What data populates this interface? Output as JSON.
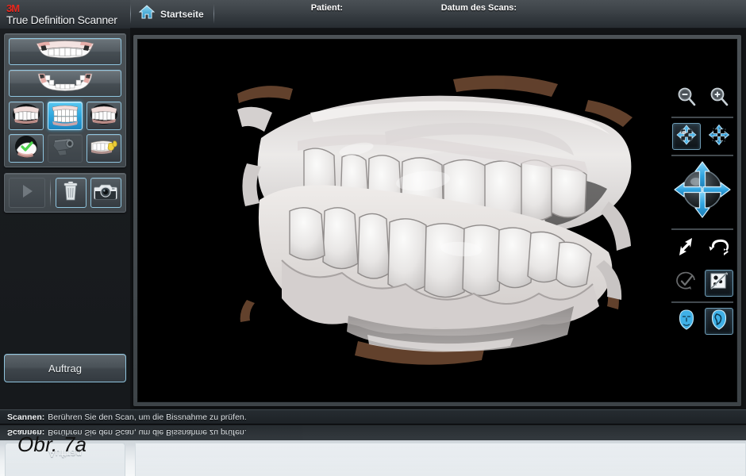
{
  "header": {
    "brand_logo": "3M",
    "brand_name": "True Definition Scanner",
    "home_label": "Startseite",
    "home_icon": "home-icon",
    "patient_label": "Patient:",
    "patient_value": "",
    "scandate_label": "Datum des Scans:",
    "scandate_value": ""
  },
  "sidebar": {
    "arch_buttons": [
      {
        "name": "upper-arch-button",
        "icon": "upper-dental-arch-icon",
        "label": "",
        "selected": false
      },
      {
        "name": "lower-arch-button",
        "icon": "lower-dental-arch-icon",
        "label": "",
        "selected": false
      }
    ],
    "view_tools": [
      {
        "name": "view-buccal-left-button",
        "icon": "teeth-left-buccal-icon",
        "selected": false
      },
      {
        "name": "view-bite-front-button",
        "icon": "teeth-front-bite-icon",
        "selected": true
      },
      {
        "name": "view-buccal-right-button",
        "icon": "teeth-right-buccal-icon",
        "selected": false
      },
      {
        "name": "margin-marking-button",
        "icon": "tooth-prep-check-icon",
        "selected": false
      },
      {
        "name": "scanner-wand-button",
        "icon": "scanner-handpiece-icon",
        "selected": false,
        "disabled": true
      },
      {
        "name": "restoration-button",
        "icon": "crown-restoration-icon",
        "selected": false
      }
    ],
    "actions": [
      {
        "name": "play-button",
        "icon": "play-triangle-icon",
        "disabled": true
      },
      {
        "name": "delete-button",
        "icon": "trash-can-icon",
        "disabled": false
      },
      {
        "name": "camera-button",
        "icon": "camera-icon",
        "disabled": false
      }
    ],
    "order_button_label": "Auftrag"
  },
  "rail": {
    "rows": [
      [
        {
          "name": "zoom-out-button",
          "icon": "magnifier-minus-icon",
          "state": "normal"
        },
        {
          "name": "zoom-in-button",
          "icon": "magnifier-plus-icon",
          "state": "normal"
        }
      ],
      [
        {
          "name": "rotate-model-button",
          "icon": "rotate-model-arrows-icon",
          "state": "selected"
        },
        {
          "name": "pan-model-button",
          "icon": "pan-four-arrows-icon",
          "state": "normal"
        }
      ],
      [
        {
          "name": "navigation-pad",
          "icon": "four-way-navigation-sphere-icon",
          "state": "normal"
        }
      ],
      [
        {
          "name": "rotate-diagonal-button",
          "icon": "diagonal-rotate-arrows-icon",
          "state": "normal"
        },
        {
          "name": "rotate-circular-button",
          "icon": "circular-rotate-arrow-icon",
          "state": "normal"
        }
      ],
      [
        {
          "name": "accept-scan-button",
          "icon": "checkmark-circle-icon",
          "state": "disabled"
        },
        {
          "name": "texture-toggle-button",
          "icon": "texture-image-toggle-icon",
          "state": "selected"
        }
      ],
      [
        {
          "name": "face-front-view-button",
          "icon": "face-front-icon",
          "state": "normal"
        },
        {
          "name": "face-profile-view-button",
          "icon": "face-profile-icon",
          "state": "selected"
        }
      ]
    ]
  },
  "viewport": {
    "name": "scan-3d-viewport",
    "model": "dental-arch-bite-3d-scan",
    "background_color": "#000000"
  },
  "status": {
    "label": "Scannen:",
    "text": "Berühren Sie den Scan, um die Bissnahme zu prüfen."
  },
  "figure": {
    "caption": "Obr. 7a"
  },
  "colors": {
    "accent_blue": "#2ba3dc",
    "brand_red": "#e8281e",
    "chrome_dark": "#3c4247",
    "panel_gray": "#474e54",
    "viewport_black": "#000000"
  }
}
